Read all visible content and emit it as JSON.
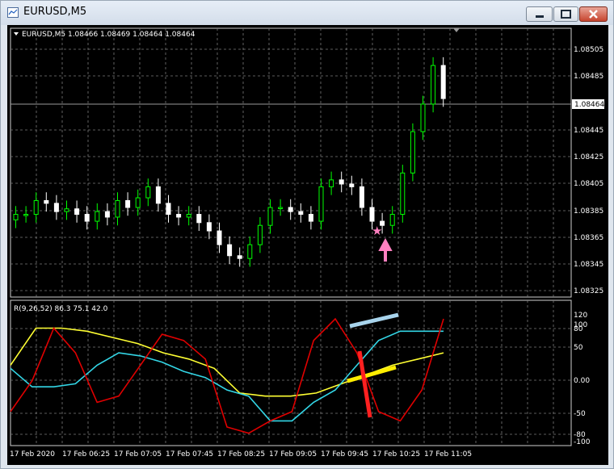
{
  "window": {
    "title": "EURUSD,M5"
  },
  "main_chart": {
    "header": "EURUSD,M5  1.08466 1.08469 1.08464 1.08464",
    "price_levels": [
      "1.08505",
      "1.08485",
      "1.08464",
      "1.08445",
      "1.08425",
      "1.08405",
      "1.08385",
      "1.08365",
      "1.08345",
      "1.08325"
    ],
    "current_price": "1.08464"
  },
  "indicator": {
    "header": "R(9,26,52) 86.3 75.1 42.0",
    "levels": [
      "120",
      "100",
      "80",
      "50",
      "0.00",
      "-50",
      "-80",
      "-100"
    ]
  },
  "time_axis": [
    "17 Feb 2020",
    "17 Feb 06:25",
    "17 Feb 07:05",
    "17 Feb 07:45",
    "17 Feb 08:25",
    "17 Feb 09:05",
    "17 Feb 09:45",
    "17 Feb 10:25",
    "17 Feb 11:05"
  ],
  "colors": {
    "background": "#000000",
    "grid": "#8a8a8a",
    "bull_candle": "#00ff00",
    "bear_candle": "#ffffff",
    "line_red": "#e00000",
    "line_cyan": "#33d6e6",
    "line_yellow": "#ffff33",
    "marker": "#ff80c0"
  },
  "chart_data": {
    "type": "candlestick",
    "ohlc_close": [
      1.0838,
      1.0838,
      1.0839,
      1.08388,
      1.08382,
      1.08384,
      1.0838,
      1.08375,
      1.08382,
      1.08378,
      1.0839,
      1.08385,
      1.08392,
      1.084,
      1.08388,
      1.0838,
      1.08378,
      1.0838,
      1.08374,
      1.08368,
      1.08358,
      1.0835,
      1.08348,
      1.08358,
      1.08372,
      1.08385,
      1.08385,
      1.08382,
      1.0838,
      1.08375,
      1.084,
      1.08405,
      1.08402,
      1.084,
      1.08385,
      1.08375,
      1.08372,
      1.0838,
      1.0841,
      1.0844,
      1.0846,
      1.08488,
      1.08464
    ],
    "ylim": [
      1.0832,
      1.08515
    ],
    "indicator_series": [
      {
        "name": "R(9)",
        "values": [
          -55,
          -5,
          80,
          40,
          -40,
          -30,
          20,
          70,
          60,
          30,
          -80,
          -90,
          -70,
          -55,
          60,
          95,
          40,
          -55,
          -70,
          -20,
          95
        ]
      },
      {
        "name": "R(26)",
        "values": [
          15,
          -15,
          -15,
          -10,
          20,
          40,
          35,
          25,
          10,
          0,
          -20,
          -30,
          -70,
          -70,
          -40,
          -20,
          20,
          60,
          75,
          75,
          75
        ]
      },
      {
        "name": "R(52)",
        "values": [
          20,
          80,
          80,
          75,
          65,
          55,
          40,
          30,
          15,
          -25,
          -30,
          -30,
          -25,
          -10,
          5,
          20,
          30,
          40
        ]
      }
    ],
    "indicator_ylim": [
      -110,
      125
    ]
  }
}
